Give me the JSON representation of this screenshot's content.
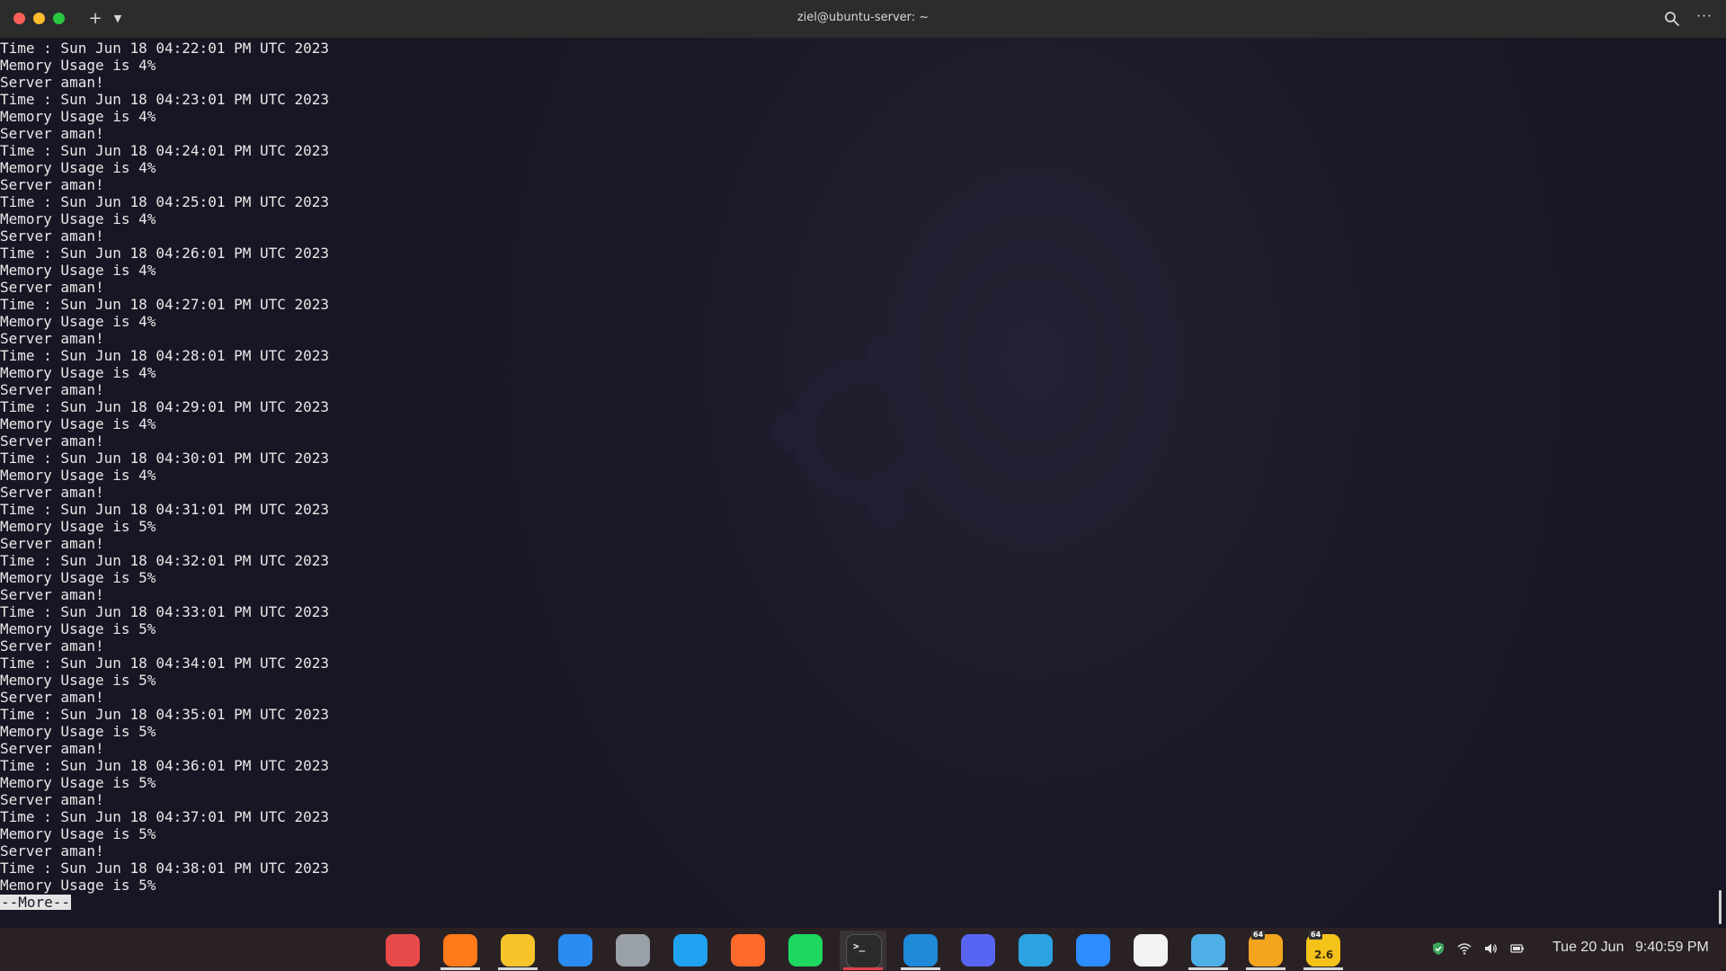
{
  "window": {
    "title": "ziel@ubuntu-server: ~"
  },
  "terminal": {
    "lines": [
      "Time : Sun Jun 18 04:22:01 PM UTC 2023",
      "Memory Usage is 4%",
      "Server aman!",
      "Time : Sun Jun 18 04:23:01 PM UTC 2023",
      "Memory Usage is 4%",
      "Server aman!",
      "Time : Sun Jun 18 04:24:01 PM UTC 2023",
      "Memory Usage is 4%",
      "Server aman!",
      "Time : Sun Jun 18 04:25:01 PM UTC 2023",
      "Memory Usage is 4%",
      "Server aman!",
      "Time : Sun Jun 18 04:26:01 PM UTC 2023",
      "Memory Usage is 4%",
      "Server aman!",
      "Time : Sun Jun 18 04:27:01 PM UTC 2023",
      "Memory Usage is 4%",
      "Server aman!",
      "Time : Sun Jun 18 04:28:01 PM UTC 2023",
      "Memory Usage is 4%",
      "Server aman!",
      "Time : Sun Jun 18 04:29:01 PM UTC 2023",
      "Memory Usage is 4%",
      "Server aman!",
      "Time : Sun Jun 18 04:30:01 PM UTC 2023",
      "Memory Usage is 4%",
      "Server aman!",
      "Time : Sun Jun 18 04:31:01 PM UTC 2023",
      "Memory Usage is 5%",
      "Server aman!",
      "Time : Sun Jun 18 04:32:01 PM UTC 2023",
      "Memory Usage is 5%",
      "Server aman!",
      "Time : Sun Jun 18 04:33:01 PM UTC 2023",
      "Memory Usage is 5%",
      "Server aman!",
      "Time : Sun Jun 18 04:34:01 PM UTC 2023",
      "Memory Usage is 5%",
      "Server aman!",
      "Time : Sun Jun 18 04:35:01 PM UTC 2023",
      "Memory Usage is 5%",
      "Server aman!",
      "Time : Sun Jun 18 04:36:01 PM UTC 2023",
      "Memory Usage is 5%",
      "Server aman!",
      "Time : Sun Jun 18 04:37:01 PM UTC 2023",
      "Memory Usage is 5%",
      "Server aman!",
      "Time : Sun Jun 18 04:38:01 PM UTC 2023",
      "Memory Usage is 5%"
    ],
    "more_prompt": "--More--"
  },
  "dock": {
    "apps": [
      {
        "icon": "screenshot-tool-icon",
        "color": "#e84a4a",
        "active": false,
        "open": false
      },
      {
        "icon": "firefox-icon",
        "color": "#ff7a1a",
        "active": false,
        "open": true
      },
      {
        "icon": "files-icon",
        "color": "#f7c52b",
        "active": false,
        "open": true
      },
      {
        "icon": "mail-icon",
        "color": "#2a8cf0",
        "active": false,
        "open": false
      },
      {
        "icon": "settings-icon",
        "color": "#9aa0a8",
        "active": false,
        "open": false
      },
      {
        "icon": "browser-icon",
        "color": "#1fa3f0",
        "active": false,
        "open": false
      },
      {
        "icon": "app-store-icon",
        "color": "#ff6a2a",
        "active": false,
        "open": false
      },
      {
        "icon": "spotify-icon",
        "color": "#1ed760",
        "active": false,
        "open": false
      },
      {
        "icon": "terminal-icon",
        "color": "#2b2b2b",
        "active": true,
        "open": true
      },
      {
        "icon": "vscode-icon",
        "color": "#1f8ad8",
        "active": false,
        "open": true
      },
      {
        "icon": "discord-icon",
        "color": "#5865f2",
        "active": false,
        "open": false
      },
      {
        "icon": "telegram-icon",
        "color": "#2aa3e0",
        "active": false,
        "open": false
      },
      {
        "icon": "zoom-icon",
        "color": "#2d8cff",
        "active": false,
        "open": false
      },
      {
        "icon": "notion-icon",
        "color": "#f2f2f2",
        "active": false,
        "open": false
      },
      {
        "icon": "virtualbox-icon",
        "color": "#4fb0e8",
        "active": false,
        "open": true
      },
      {
        "icon": "dev-tool-icon",
        "color": "#f2a41e",
        "active": false,
        "open": true,
        "badge": "64"
      },
      {
        "icon": "python-ide-icon",
        "color": "#f5c21a",
        "active": false,
        "open": true,
        "badge": "64",
        "label": "2.6"
      }
    ]
  },
  "tray": {
    "icons": [
      "shield-icon",
      "wifi-icon",
      "volume-icon",
      "battery-icon"
    ],
    "date": "Tue 20 Jun",
    "time": "9:40:59 PM"
  }
}
